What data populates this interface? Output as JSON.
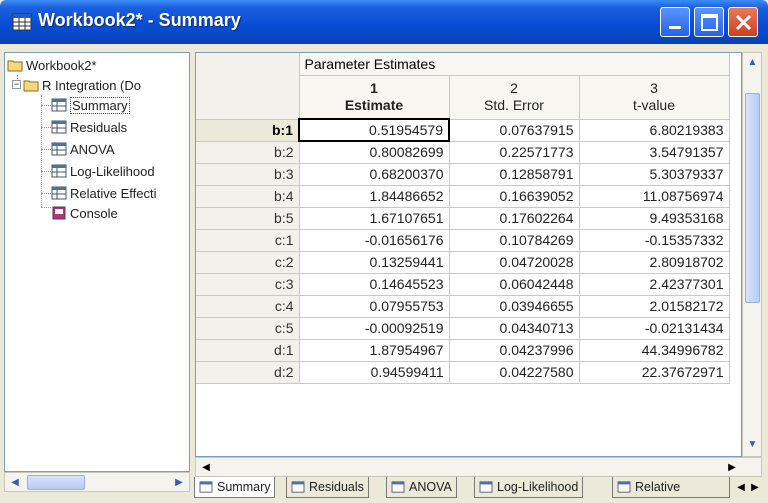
{
  "window": {
    "title": "Workbook2* - Summary"
  },
  "tree": {
    "root": "Workbook2*",
    "folder": "R Integration (Do",
    "items": [
      {
        "label": "Summary",
        "icon": "sheet-icon",
        "selected": true
      },
      {
        "label": "Residuals",
        "icon": "sheet-icon"
      },
      {
        "label": "ANOVA",
        "icon": "sheet-icon"
      },
      {
        "label": "Log-Likelihood",
        "icon": "sheet-icon"
      },
      {
        "label": "Relative Effecti",
        "icon": "sheet-icon"
      },
      {
        "label": "Console",
        "icon": "console-icon"
      }
    ]
  },
  "grid": {
    "section_title": "Parameter Estimates",
    "columns": [
      {
        "number": "1",
        "name": "Estimate",
        "bold": true
      },
      {
        "number": "2",
        "name": "Std. Error"
      },
      {
        "number": "3",
        "name": "t-value"
      }
    ],
    "rows": [
      {
        "label": "b:1",
        "estimate": "0.51954579",
        "std_error": "0.07637915",
        "t_value": "6.80219383",
        "active": true
      },
      {
        "label": "b:2",
        "estimate": "0.80082699",
        "std_error": "0.22571773",
        "t_value": "3.54791357"
      },
      {
        "label": "b:3",
        "estimate": "0.68200370",
        "std_error": "0.12858791",
        "t_value": "5.30379337"
      },
      {
        "label": "b:4",
        "estimate": "1.84486652",
        "std_error": "0.16639052",
        "t_value": "11.08756974"
      },
      {
        "label": "b:5",
        "estimate": "1.67107651",
        "std_error": "0.17602264",
        "t_value": "9.49353168"
      },
      {
        "label": "c:1",
        "estimate": "-0.01656176",
        "std_error": "0.10784269",
        "t_value": "-0.15357332"
      },
      {
        "label": "c:2",
        "estimate": "0.13259441",
        "std_error": "0.04720028",
        "t_value": "2.80918702"
      },
      {
        "label": "c:3",
        "estimate": "0.14645523",
        "std_error": "0.06042448",
        "t_value": "2.42377301"
      },
      {
        "label": "c:4",
        "estimate": "0.07955753",
        "std_error": "0.03946655",
        "t_value": "2.01582172"
      },
      {
        "label": "c:5",
        "estimate": "-0.00092519",
        "std_error": "0.04340713",
        "t_value": "-0.02131434"
      },
      {
        "label": "d:1",
        "estimate": "1.87954967",
        "std_error": "0.04237996",
        "t_value": "44.34996782"
      },
      {
        "label": "d:2",
        "estimate": "0.94599411",
        "std_error": "0.04227580",
        "t_value": "22.37672971"
      }
    ]
  },
  "tabs": [
    {
      "label": "Summary",
      "active": true
    },
    {
      "label": "Residuals"
    },
    {
      "label": "ANOVA"
    },
    {
      "label": "Log-Likelihood"
    },
    {
      "label": "Relative"
    }
  ],
  "colors": {
    "titlebar": "#0a4fd6",
    "close_button": "#c9411f",
    "active_row_header": "#ece9d8"
  }
}
